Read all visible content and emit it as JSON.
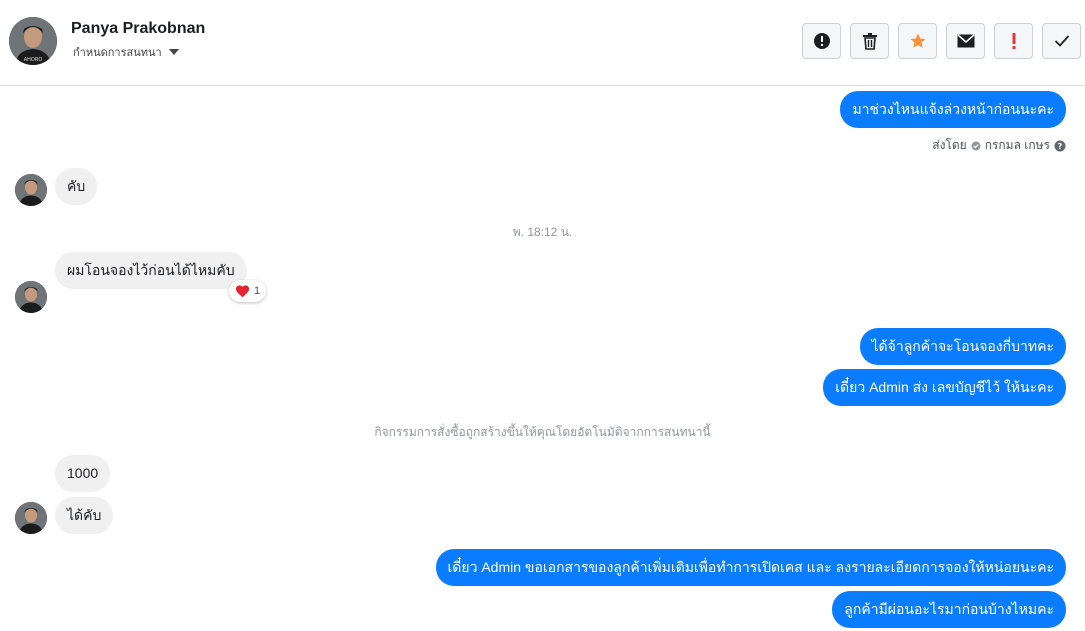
{
  "header": {
    "contact_name": "Panya Prakobnan",
    "conversation_setting": "กำหนดการสนทนา",
    "toolbar": [
      {
        "name": "spam-alert-button",
        "icon": "exclamation-circle-icon"
      },
      {
        "name": "delete-button",
        "icon": "trash-icon"
      },
      {
        "name": "star-button",
        "icon": "star-icon",
        "color": "#f7923b"
      },
      {
        "name": "mark-unread-button",
        "icon": "envelope-icon"
      },
      {
        "name": "important-button",
        "icon": "exclamation-icon",
        "color": "#e0393e"
      },
      {
        "name": "done-button",
        "icon": "check-icon"
      }
    ]
  },
  "messages": {
    "out1": "มาช่วงไหนแจ้งล่วงหน้าก่อนนะคะ",
    "sent_by_label": "ส่งโดย",
    "sent_by_name": "กรกมล เกษร",
    "in1": "คับ",
    "timestamp": "พ. 18:12 น.",
    "in2": "ผมโอนจองไว้ก่อนได้ไหมคับ",
    "reaction_count": "1",
    "out2": "ได้จ้าลูกค้าจะโอนจองกี่บาทคะ",
    "out3": "เดี๋ยว Admin ส่ง เลขบัญชีไว้ ให้นะคะ",
    "system_note": "กิจกรรมการสั่งซื้อถูกสร้างขึ้นให้คุณโดยอัตโนมัติจากการสนทนานี้",
    "in3": "1000",
    "in4": "ได้คับ",
    "out4": "เดี๋ยว Admin ขอเอกสารของลูกค้าเพิ่มเติมเพื่อทำการเปิดเคส และ ลงรายละเอียดการจองให้หน่อยนะคะ",
    "out5": "ลูกค้ามีผ่อนอะไรมาก่อนบ้างไหมคะ"
  },
  "colors": {
    "outgoing_bubble": "#0a7cff",
    "incoming_bubble": "#f0f0f0",
    "star": "#f7923b",
    "important": "#e0393e"
  }
}
